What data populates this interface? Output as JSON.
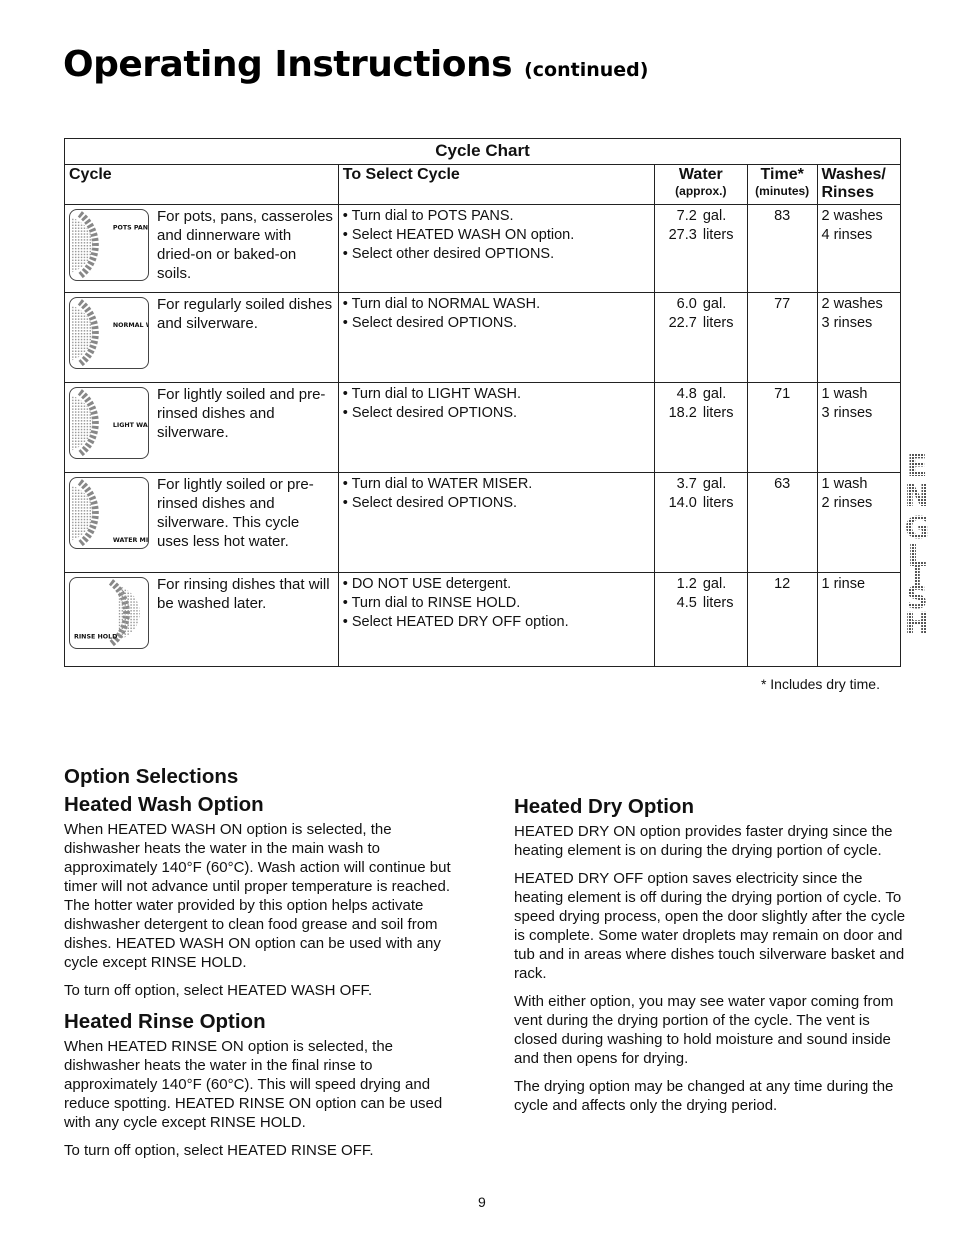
{
  "page": {
    "title": "Operating Instructions",
    "title_suffix": "(continued)",
    "page_number": "9",
    "side_tab": "ENGLISH"
  },
  "cycle_chart": {
    "caption": "Cycle Chart",
    "headers": {
      "cycle": "Cycle",
      "to_select": "To Select Cycle",
      "water": "Water",
      "water_sub": "(approx.)",
      "time": "Time*",
      "time_sub": "(minutes)",
      "washes_rinses": "Washes/ Rinses"
    },
    "rows": [
      {
        "dial_label": "POTS PANS",
        "description": "For pots, pans, casseroles and dinnerware with dried-on or baked-on soils.",
        "steps": [
          "• Turn dial to POTS PANS.",
          "• Select HEATED WASH ON option.",
          "• Select other desired OPTIONS."
        ],
        "water_gal": "7.2",
        "gal_unit": "gal.",
        "water_liters": "27.3",
        "liters_unit": "liters",
        "time": "83",
        "washes": "2 washes",
        "rinses": "4 rinses"
      },
      {
        "dial_label": "NORMAL WASH",
        "description": "For regularly soiled dishes and silverware.",
        "steps": [
          "• Turn dial to NORMAL WASH.",
          "• Select desired OPTIONS."
        ],
        "water_gal": "6.0",
        "gal_unit": "gal.",
        "water_liters": "22.7",
        "liters_unit": "liters",
        "time": "77",
        "washes": "2 washes",
        "rinses": "3 rinses"
      },
      {
        "dial_label": "LIGHT WASH",
        "description": "For lightly soiled and pre-rinsed dishes and silverware.",
        "steps": [
          "• Turn dial to LIGHT WASH.",
          "• Select desired OPTIONS."
        ],
        "water_gal": "4.8",
        "gal_unit": "gal.",
        "water_liters": "18.2",
        "liters_unit": "liters",
        "time": "71",
        "washes": "1 wash",
        "rinses": "3 rinses"
      },
      {
        "dial_label": "WATER MISER",
        "description": "For lightly soiled or pre-rinsed dishes and silverware. This cycle uses less hot water.",
        "steps": [
          "• Turn dial to WATER MISER.",
          "• Select desired OPTIONS."
        ],
        "water_gal": "3.7",
        "gal_unit": "gal.",
        "water_liters": "14.0",
        "liters_unit": "liters",
        "time": "63",
        "washes": "1 wash",
        "rinses": "2 rinses"
      },
      {
        "dial_label": "RINSE HOLD",
        "description": "For rinsing dishes that will be washed later.",
        "steps": [
          "• DO NOT USE detergent.",
          "• Turn dial to RINSE HOLD.",
          "• Select HEATED DRY OFF option."
        ],
        "water_gal": "1.2",
        "gal_unit": "gal.",
        "water_liters": "4.5",
        "liters_unit": "liters",
        "time": "12",
        "washes": "1 rinse",
        "rinses": ""
      }
    ],
    "footnote": "* Includes dry time."
  },
  "options": {
    "heading": "Option Selections",
    "heated_wash": {
      "title": "Heated  Wash Option",
      "p1": "When HEATED WASH ON option is selected, the dishwasher heats the water in the main wash to approximately 140°F (60°C). Wash action will continue but timer will not advance until proper temperature is reached. The hotter water provided by this option helps activate dishwasher detergent to clean food grease and soil from dishes. HEATED WASH ON option can be used with any cycle except RINSE HOLD.",
      "p2": "To turn off option, select HEATED WASH OFF."
    },
    "heated_rinse": {
      "title": "Heated Rinse Option",
      "p1": "When HEATED RINSE ON option is selected, the dishwasher heats the water in the final rinse to approximately 140°F (60°C).  This will speed drying and reduce spotting. HEATED RINSE ON option can be used with any cycle except RINSE HOLD.",
      "p2": "To turn off option, select HEATED RINSE OFF."
    },
    "heated_dry": {
      "title": "Heated Dry Option",
      "p1": "HEATED DRY ON option provides faster drying since the heating element is on during the drying portion of cycle.",
      "p2": "HEATED DRY OFF option saves electricity since the heating element is off during the drying portion of cycle. To speed drying process, open the door slightly after the cycle is complete. Some water droplets may remain on door and tub and in areas where dishes touch silverware basket and rack.",
      "p3": "With either option, you may see water vapor coming from vent during the drying portion of the cycle. The vent is closed during washing to hold moisture and sound inside and then opens for drying.",
      "p4": "The drying option may be changed at any time during the cycle and affects only the drying period."
    }
  }
}
